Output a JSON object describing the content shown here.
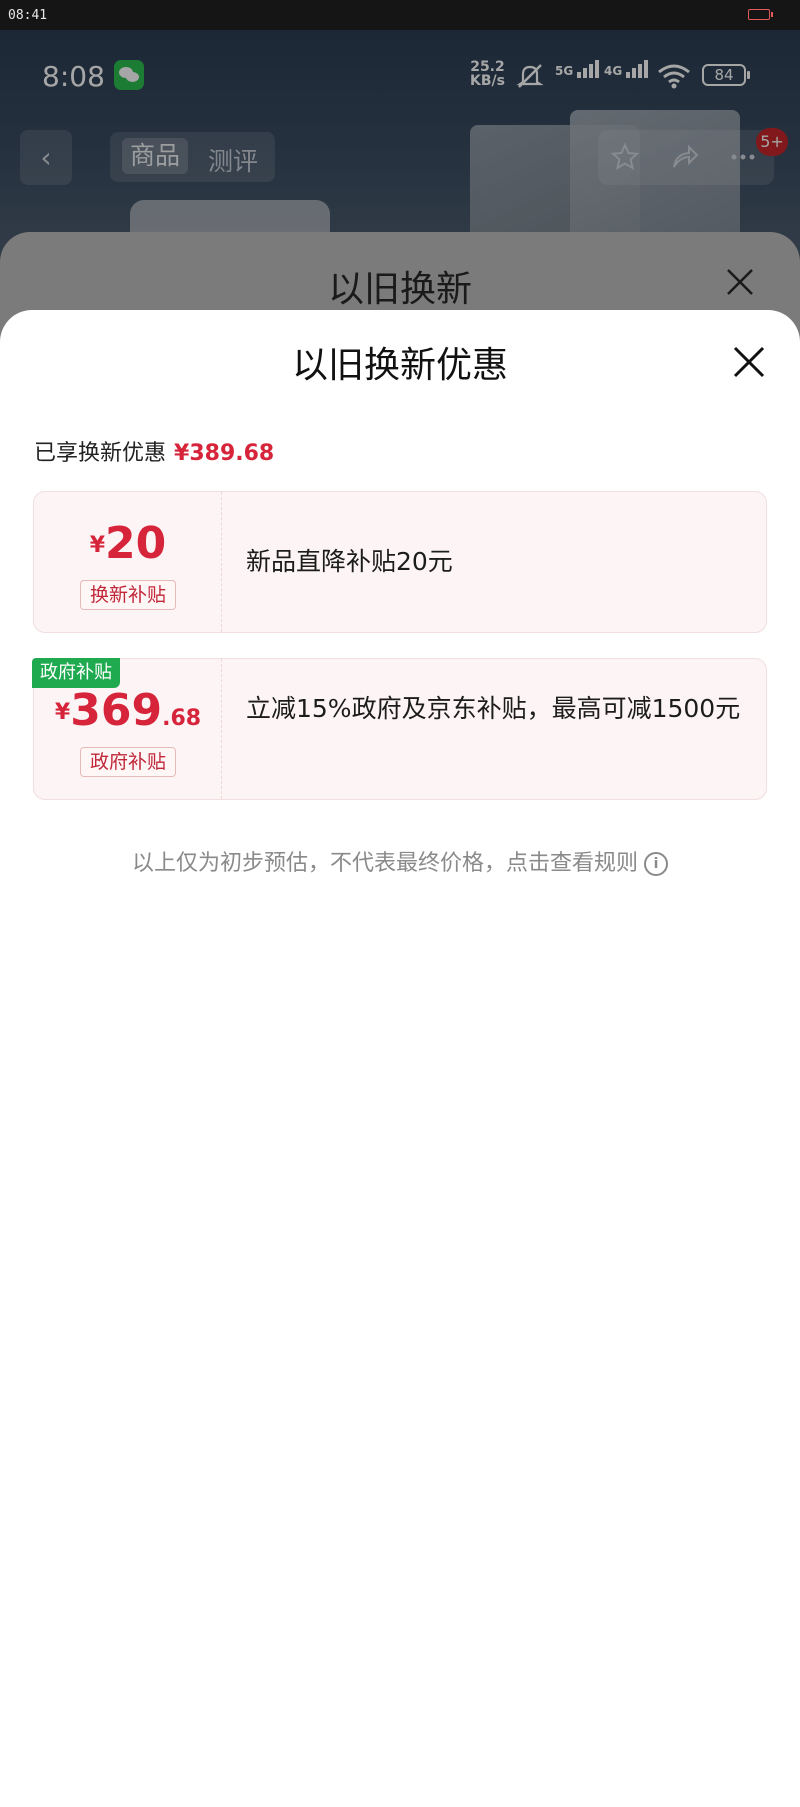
{
  "outer_status": {
    "time": "08:41"
  },
  "phone_status": {
    "time": "8:08",
    "net_speed_value": "25.2",
    "net_speed_unit": "KB/s",
    "sim1_label": "5G",
    "sim2_label": "4G",
    "battery": "84"
  },
  "product_nav": {
    "back_icon": "chevron-left-icon",
    "tabs": [
      {
        "label": "商品",
        "active": true
      },
      {
        "label": "测评",
        "active": false
      }
    ],
    "cart_badge": "5+"
  },
  "back_sheet": {
    "title": "以旧换新"
  },
  "sheet": {
    "title": "以旧换新优惠",
    "enjoyed_label": "已享换新优惠",
    "enjoyed_amount": "¥389.68",
    "cards": [
      {
        "currency": "¥",
        "amount_int": "20",
        "amount_dec": "",
        "tag": "换新补贴",
        "description": "新品直降补贴20元"
      },
      {
        "badge": "政府补贴",
        "currency": "¥",
        "amount_int": "369",
        "amount_dec": ".68",
        "tag": "政府补贴",
        "description": "立减15%政府及京东补贴，最高可减1500元"
      }
    ],
    "note": "以上仅为初步预估，不代表最终价格，点击查看规则",
    "note_icon": "info-icon"
  },
  "colors": {
    "accent_red": "#d6243a",
    "gov_green": "#1faa4f",
    "card_bg": "#fdf5f5"
  }
}
